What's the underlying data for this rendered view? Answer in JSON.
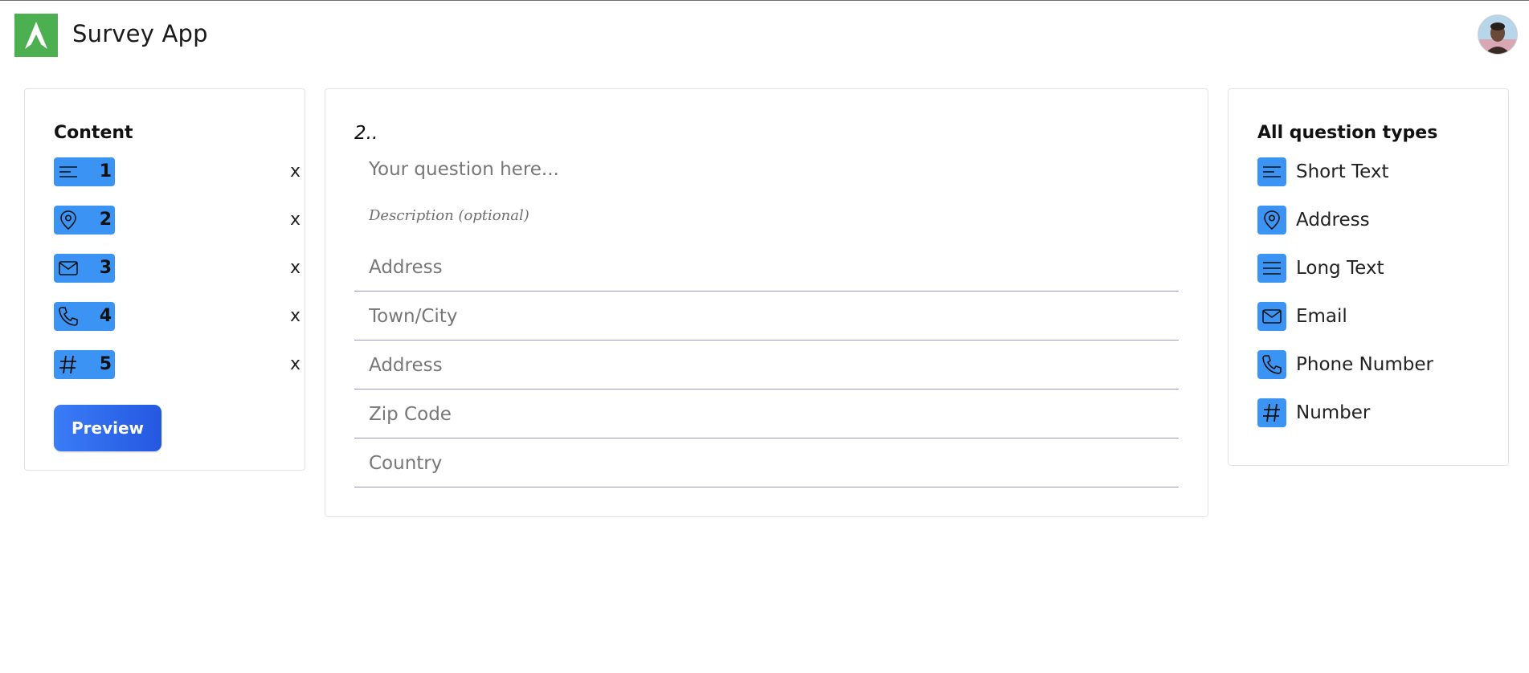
{
  "app": {
    "title": "Survey App",
    "brand_color": "#4caf50",
    "accent_color": "#3b94f4"
  },
  "content_panel": {
    "title": "Content",
    "items": [
      {
        "icon": "short-text-icon",
        "number": "1",
        "remove": "x"
      },
      {
        "icon": "location-pin-icon",
        "number": "2",
        "remove": "x"
      },
      {
        "icon": "email-icon",
        "number": "3",
        "remove": "x"
      },
      {
        "icon": "phone-icon",
        "number": "4",
        "remove": "x"
      },
      {
        "icon": "hash-icon",
        "number": "5",
        "remove": "x"
      }
    ],
    "preview_label": "Preview"
  },
  "editor": {
    "question_number": "2..",
    "question_placeholder": "Your question here...",
    "description_placeholder": "Description (optional)",
    "fields": [
      {
        "placeholder": "Address"
      },
      {
        "placeholder": "Town/City"
      },
      {
        "placeholder": "Address"
      },
      {
        "placeholder": "Zip Code"
      },
      {
        "placeholder": "Country"
      }
    ]
  },
  "types_panel": {
    "title": "All question types",
    "items": [
      {
        "icon": "short-text-icon",
        "label": "Short Text"
      },
      {
        "icon": "location-pin-icon",
        "label": "Address"
      },
      {
        "icon": "long-text-icon",
        "label": "Long Text"
      },
      {
        "icon": "email-icon",
        "label": "Email"
      },
      {
        "icon": "phone-icon",
        "label": "Phone Number"
      },
      {
        "icon": "hash-icon",
        "label": "Number"
      }
    ]
  }
}
